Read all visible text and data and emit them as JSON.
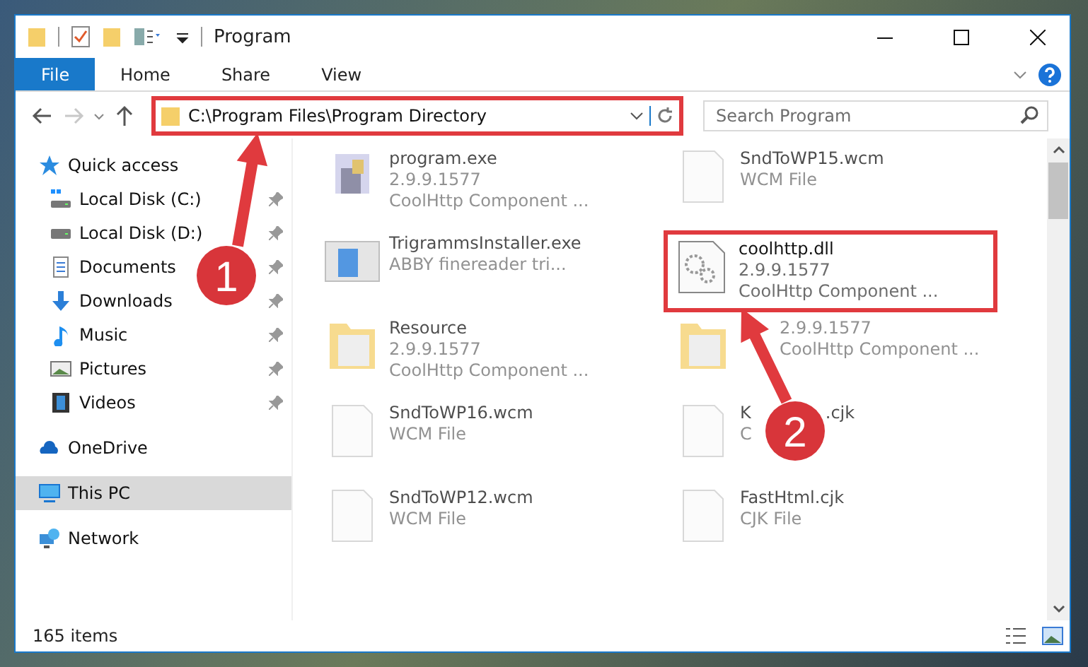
{
  "window": {
    "title": "Program"
  },
  "ribbon": {
    "tabs": [
      {
        "label": "File",
        "kind": "file",
        "selected": false
      },
      {
        "label": "Home",
        "kind": "tab",
        "selected": false
      },
      {
        "label": "Share",
        "kind": "tab",
        "selected": false
      },
      {
        "label": "View",
        "kind": "tab",
        "selected": false
      }
    ]
  },
  "address": {
    "value": "C:\\Program Files\\Program Directory",
    "highlighted": true
  },
  "search": {
    "placeholder": "Search Program"
  },
  "sidebar": {
    "items": [
      {
        "label": "Quick access",
        "kind": "star",
        "selected": false,
        "children": [
          {
            "label": "Local Disk (C:)",
            "kind": "system-drive",
            "pinned": true,
            "selected": false
          },
          {
            "label": "Local Disk (D:)",
            "kind": "drive",
            "pinned": true,
            "selected": false
          },
          {
            "label": "Documents",
            "kind": "documents",
            "pinned": true,
            "selected": false
          },
          {
            "label": "Downloads",
            "kind": "downloads",
            "pinned": true,
            "selected": false
          },
          {
            "label": "Music",
            "kind": "music",
            "pinned": true,
            "selected": false
          },
          {
            "label": "Pictures",
            "kind": "pictures",
            "pinned": true,
            "selected": false
          },
          {
            "label": "Videos",
            "kind": "videos",
            "pinned": true,
            "selected": false
          }
        ]
      },
      {
        "label": "OneDrive",
        "kind": "cloud",
        "selected": false
      },
      {
        "label": "This PC",
        "kind": "pc",
        "selected": true
      },
      {
        "label": "Network",
        "kind": "network",
        "selected": false
      }
    ]
  },
  "files": [
    {
      "kind": "exe",
      "name": "program.exe",
      "details": [
        "2.9.9.1577",
        "CoolHttp Component ..."
      ],
      "highlighted": false
    },
    {
      "kind": "document",
      "name": "SndToWP15.wcm",
      "details": [
        "WCM File"
      ],
      "highlighted": false
    },
    {
      "kind": "installer",
      "name": "TrigrammsInstaller.exe",
      "details": [
        "ABBY finereader tri..."
      ],
      "highlighted": false
    },
    {
      "kind": "dll",
      "name": "coolhttp.dll",
      "details": [
        "2.9.9.1577",
        "CoolHttp Component ..."
      ],
      "highlighted": true
    },
    {
      "kind": "folder",
      "name": "Resource",
      "details": [
        "2.9.9.1577",
        "CoolHttp Component ..."
      ],
      "highlighted": false
    },
    {
      "kind": "folder",
      "details": [
        "2.9.9.1577",
        "CoolHttp Component ..."
      ],
      "highlighted": false
    },
    {
      "kind": "document",
      "name": "SndToWP16.wcm",
      "details": [
        "WCM File"
      ],
      "highlighted": false
    },
    {
      "kind": "document",
      "name": "K",
      "name_end": ".cjk",
      "details": [
        "C"
      ],
      "highlighted": false
    },
    {
      "kind": "document",
      "name": "SndToWP12.wcm",
      "details": [
        "WCM File"
      ],
      "highlighted": false
    },
    {
      "kind": "document",
      "name": "FastHtml.cjk",
      "details": [
        "CJK File"
      ],
      "highlighted": false
    }
  ],
  "annotations": [
    {
      "label": "1"
    },
    {
      "label": "2"
    }
  ],
  "status_bar": {
    "text": "165 items"
  }
}
